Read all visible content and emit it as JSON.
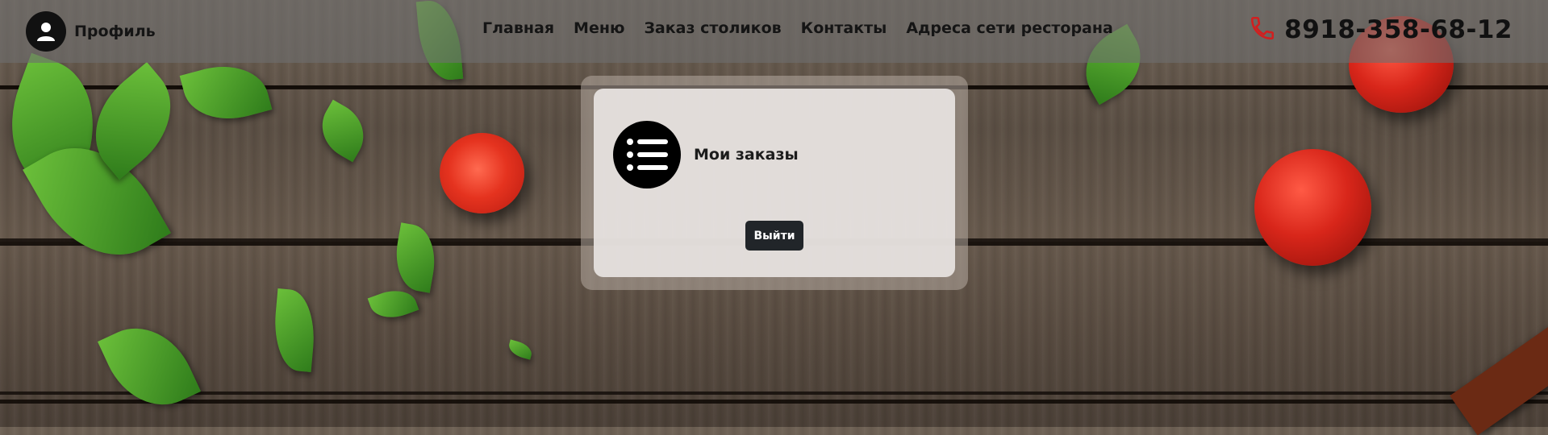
{
  "header": {
    "profile_label": "Профиль",
    "nav": [
      "Главная",
      "Меню",
      "Заказ столиков",
      "Контакты",
      "Адреса сети ресторана"
    ],
    "phone": "8918-358-68-12"
  },
  "card": {
    "orders_label": "Мои заказы",
    "logout_label": "Выйти"
  },
  "icons": {
    "profile": "user-icon",
    "phone": "phone-icon",
    "orders": "list-icon"
  },
  "colors": {
    "phone_icon": "#d11f1f",
    "button": "#212529",
    "header_bg": "#6e6e6e"
  }
}
